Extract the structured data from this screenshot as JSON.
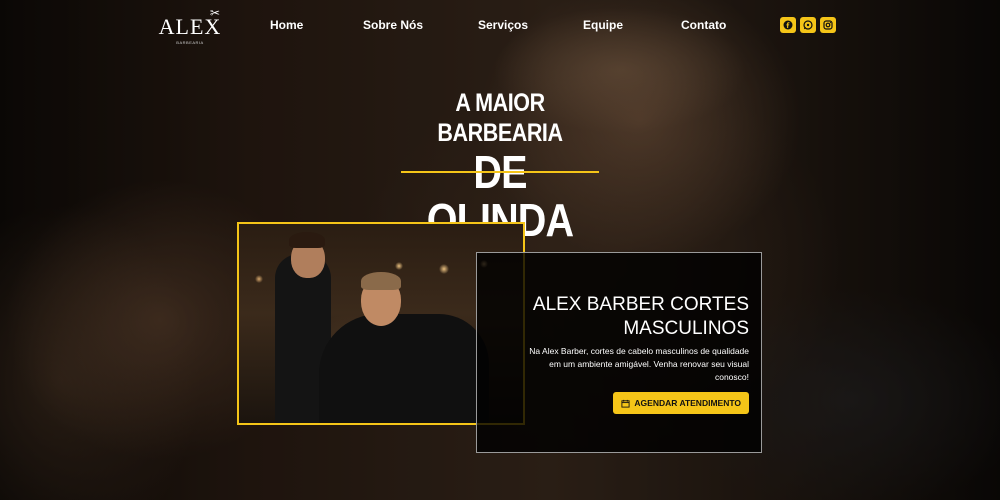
{
  "brand": {
    "logo_text": "ALEX",
    "logo_subtext": "BARBEARIA",
    "accent_color": "#f5c518"
  },
  "nav": {
    "links": [
      {
        "label": "Home"
      },
      {
        "label": "Sobre Nós"
      },
      {
        "label": "Serviços"
      },
      {
        "label": "Equipe"
      },
      {
        "label": "Contato"
      }
    ],
    "social_icons": [
      "facebook-icon",
      "whatsapp-icon",
      "instagram-icon"
    ]
  },
  "hero": {
    "headline_line1": "A MAIOR BARBEARIA",
    "headline_line2": "DE OLINDA"
  },
  "info_card": {
    "title": "ALEX BARBER CORTES MASCULINOS",
    "description": "Na Alex Barber, cortes de cabelo masculinos de qualidade em um ambiente amigável. Venha renovar seu visual conosco!",
    "button_label": "AGENDAR ATENDIMENTO",
    "button_icon": "calendar-icon"
  }
}
